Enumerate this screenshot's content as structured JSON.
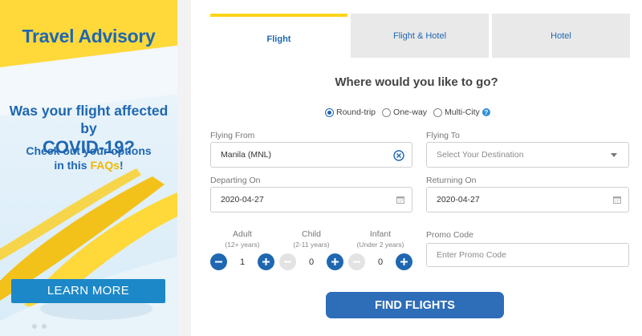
{
  "banner": {
    "title": "Travel Advisory",
    "headline_line1": "Was your flight affected by",
    "headline_line2": "COVID-19?",
    "sub_line1": "Check out your options",
    "sub_line2_prefix": "in this ",
    "sub_line2_link": "FAQs",
    "sub_line2_suffix": "!",
    "learn_more": "LEARN MORE",
    "colors": {
      "yellow": "#ffd83a",
      "blue": "#1f67b1",
      "button": "#1c88c7"
    }
  },
  "tabs": [
    {
      "label": "Flight",
      "active": true
    },
    {
      "label": "Flight & Hotel",
      "active": false
    },
    {
      "label": "Hotel",
      "active": false
    }
  ],
  "heading": "Where would you like to go?",
  "trip_types": {
    "round_trip": "Round-trip",
    "one_way": "One-way",
    "multi_city": "Multi-City",
    "selected": "Round-trip",
    "help_icon": "?"
  },
  "flying_from": {
    "label": "Flying From",
    "value": "Manila (MNL)",
    "icon": "clear-icon"
  },
  "flying_to": {
    "label": "Flying To",
    "placeholder": "Select Your Destination",
    "icon": "dropdown-caret-icon"
  },
  "departing": {
    "label": "Departing On",
    "value": "2020-04-27",
    "icon": "calendar-icon"
  },
  "returning": {
    "label": "Returning On",
    "value": "2020-04-27",
    "icon": "calendar-icon"
  },
  "passengers": {
    "adult": {
      "label": "Adult",
      "sub": "(12+ years)",
      "count": "1"
    },
    "child": {
      "label": "Child",
      "sub": "(2-11 years)",
      "count": "0"
    },
    "infant": {
      "label": "Infant",
      "sub": "(Under 2 years)",
      "count": "0"
    }
  },
  "promo": {
    "label": "Promo Code",
    "placeholder": "Enter Promo Code"
  },
  "find_button": "FIND FLIGHTS",
  "accent": "#2e6db8"
}
